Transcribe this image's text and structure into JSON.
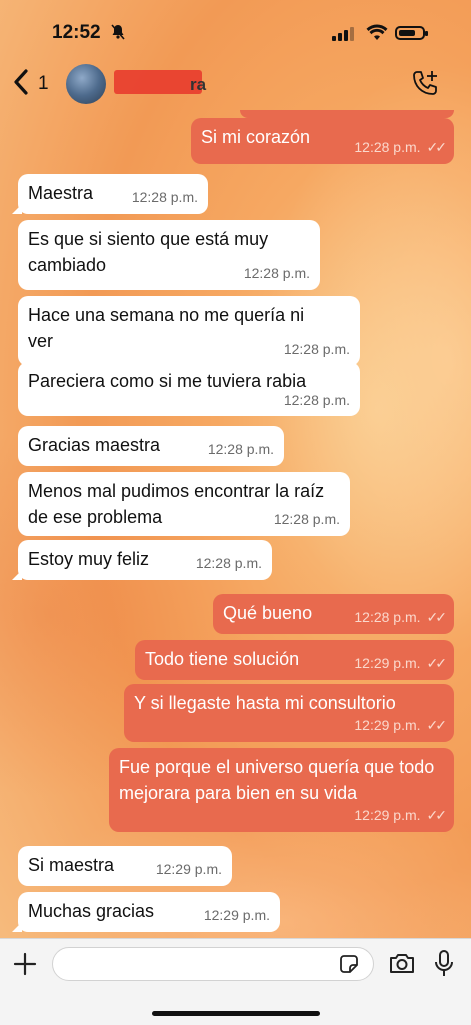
{
  "status_bar": {
    "time": "12:52"
  },
  "header": {
    "back_count": "1",
    "contact_name": "ra"
  },
  "messages": [
    {
      "dir": "out",
      "text": "Si mi corazón",
      "time": "12:28 p.m."
    },
    {
      "dir": "in",
      "text": "Maestra",
      "time": "12:28 p.m."
    },
    {
      "dir": "in",
      "text": "Es que si siento que está muy cambiado",
      "time": "12:28 p.m."
    },
    {
      "dir": "in",
      "text": "Hace una semana no me quería ni ver",
      "time": "12:28 p.m."
    },
    {
      "dir": "in",
      "text": "Pareciera como si me tuviera rabia",
      "time": "12:28 p.m."
    },
    {
      "dir": "in",
      "text": "Gracias maestra",
      "time": "12:28 p.m."
    },
    {
      "dir": "in",
      "text": "Menos mal pudimos encontrar la raíz de ese problema",
      "time": "12:28 p.m."
    },
    {
      "dir": "in",
      "text": "Estoy muy feliz",
      "time": "12:28 p.m."
    },
    {
      "dir": "out",
      "text": "Qué bueno",
      "time": "12:28 p.m."
    },
    {
      "dir": "out",
      "text": "Todo tiene solución",
      "time": "12:29 p.m."
    },
    {
      "dir": "out",
      "text": "Y si llegaste hasta mi consultorio",
      "time": "12:29 p.m."
    },
    {
      "dir": "out",
      "text": "Fue porque el universo quería que todo mejorara para bien en su vida",
      "time": "12:29 p.m."
    },
    {
      "dir": "in",
      "text": "Si maestra",
      "time": "12:29 p.m."
    },
    {
      "dir": "in",
      "text": "Muchas gracias",
      "time": "12:29 p.m."
    }
  ],
  "composer": {
    "placeholder": ""
  },
  "colors": {
    "outgoing_bubble": "#e86a4e",
    "incoming_bubble": "#ffffff"
  },
  "icons": [
    "back-chevron-icon",
    "add-call-icon",
    "plus-icon",
    "sticker-icon",
    "camera-icon",
    "microphone-icon"
  ]
}
